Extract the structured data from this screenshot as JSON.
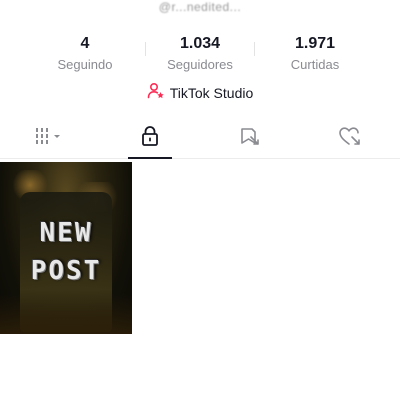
{
  "profile": {
    "username": "@r...nedited..."
  },
  "stats": [
    {
      "value": "4",
      "label": "Seguindo"
    },
    {
      "value": "1.034",
      "label": "Seguidores"
    },
    {
      "value": "1.971",
      "label": "Curtidas"
    }
  ],
  "studio": {
    "label": "TikTok Studio",
    "icon": "user-star-icon",
    "icon_color": "#fe2c55"
  },
  "tabs": [
    {
      "name": "videos-grid-tab",
      "icon": "grid-icon",
      "active": false
    },
    {
      "name": "private-tab",
      "icon": "lock-icon",
      "active": true
    },
    {
      "name": "reposts-tab",
      "icon": "repost-icon",
      "active": false
    },
    {
      "name": "liked-tab",
      "icon": "liked-heart-icon",
      "active": false
    }
  ],
  "videos": [
    {
      "overlay_line1": "NEW",
      "overlay_line2": "POST"
    }
  ]
}
